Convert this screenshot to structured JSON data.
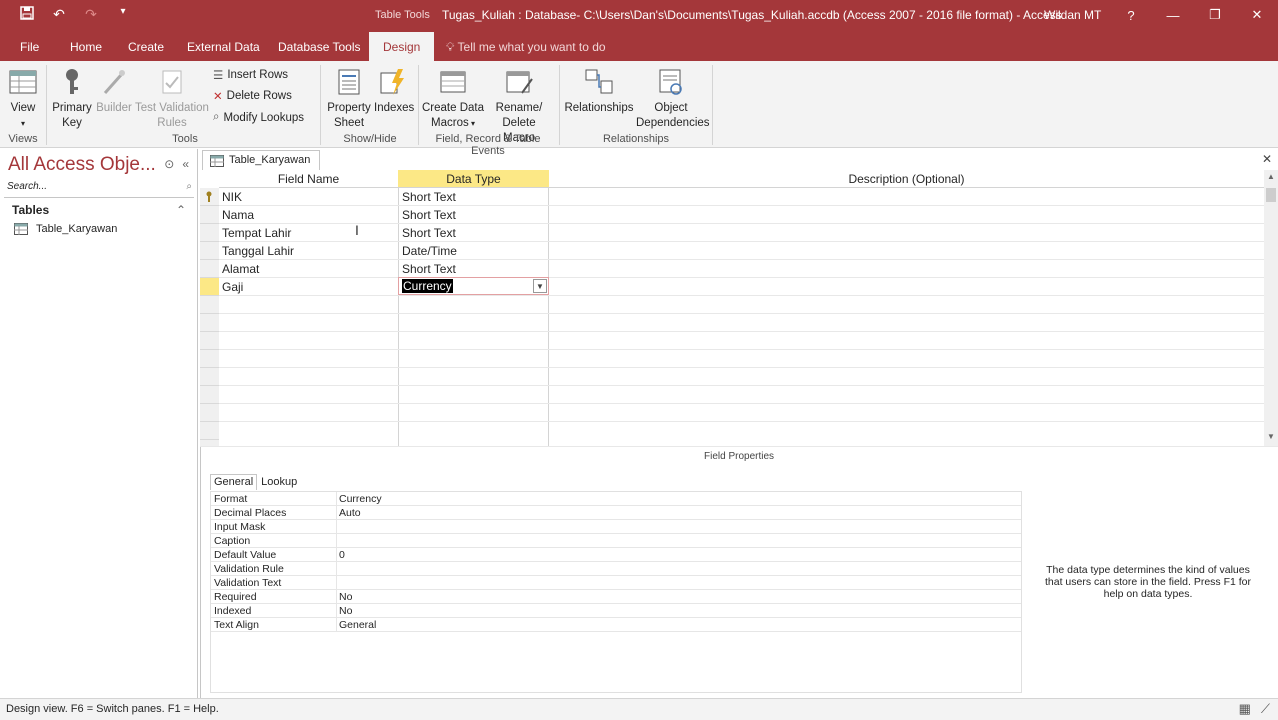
{
  "title_bar": {
    "context_label": "Table Tools",
    "window_title": "Tugas_Kuliah : Database- C:\\Users\\Dan's\\Documents\\Tugas_Kuliah.accdb (Access 2007 - 2016 file format) - Access",
    "user": "Wildan MT",
    "help": "?"
  },
  "tabs": {
    "file": "File",
    "home": "Home",
    "create": "Create",
    "external": "External Data",
    "dbtools": "Database Tools",
    "design": "Design",
    "tellme": "Tell me what you want to do"
  },
  "ribbon": {
    "view_line1": "View",
    "primary_key_l1": "Primary",
    "primary_key_l2": "Key",
    "builder": "Builder",
    "test_validation_l1": "Test Validation",
    "test_validation_l2": "Rules",
    "insert_rows": "Insert Rows",
    "delete_rows": "Delete Rows",
    "modify_lookups": "Modify Lookups",
    "property_sheet_l1": "Property",
    "property_sheet_l2": "Sheet",
    "indexes": "Indexes",
    "create_data_macros_l1": "Create Data",
    "create_data_macros_l2": "Macros",
    "rename_delete_macro_l1": "Rename/",
    "rename_delete_macro_l2": "Delete Macro",
    "relationships": "Relationships",
    "object_dependencies_l1": "Object",
    "object_dependencies_l2": "Dependencies",
    "group_views": "Views",
    "group_tools": "Tools",
    "group_showhide": "Show/Hide",
    "group_events": "Field, Record & Table Events",
    "group_relationships": "Relationships"
  },
  "nav": {
    "title": "All Access Obje...",
    "search_placeholder": "Search...",
    "section": "Tables",
    "items": [
      {
        "label": "Table_Karyawan"
      }
    ]
  },
  "document": {
    "tab_label": "Table_Karyawan",
    "columns": {
      "field_name": "Field Name",
      "data_type": "Data Type",
      "description": "Description (Optional)"
    },
    "rows": [
      {
        "field": "NIK",
        "type": "Short Text"
      },
      {
        "field": "Nama",
        "type": "Short Text"
      },
      {
        "field": "Tempat Lahir",
        "type": "Short Text"
      },
      {
        "field": "Tanggal Lahir",
        "type": "Date/Time"
      },
      {
        "field": "Alamat",
        "type": "Short Text"
      },
      {
        "field": "Gaji",
        "type": "Currency"
      }
    ]
  },
  "field_properties": {
    "title": "Field Properties",
    "tab_general": "General",
    "tab_lookup": "Lookup",
    "props": [
      {
        "k": "Format",
        "v": "Currency"
      },
      {
        "k": "Decimal Places",
        "v": "Auto"
      },
      {
        "k": "Input Mask",
        "v": ""
      },
      {
        "k": "Caption",
        "v": ""
      },
      {
        "k": "Default Value",
        "v": "0"
      },
      {
        "k": "Validation Rule",
        "v": ""
      },
      {
        "k": "Validation Text",
        "v": ""
      },
      {
        "k": "Required",
        "v": "No"
      },
      {
        "k": "Indexed",
        "v": "No"
      },
      {
        "k": "Text Align",
        "v": "General"
      }
    ],
    "help_text": "The data type determines the kind of values that users can store in the field. Press F1 for help on data types."
  },
  "status": {
    "message": "Design view.  F6 = Switch panes.  F1 = Help."
  },
  "colors": {
    "accent": "#a4373a",
    "selected_header": "#fce886"
  }
}
